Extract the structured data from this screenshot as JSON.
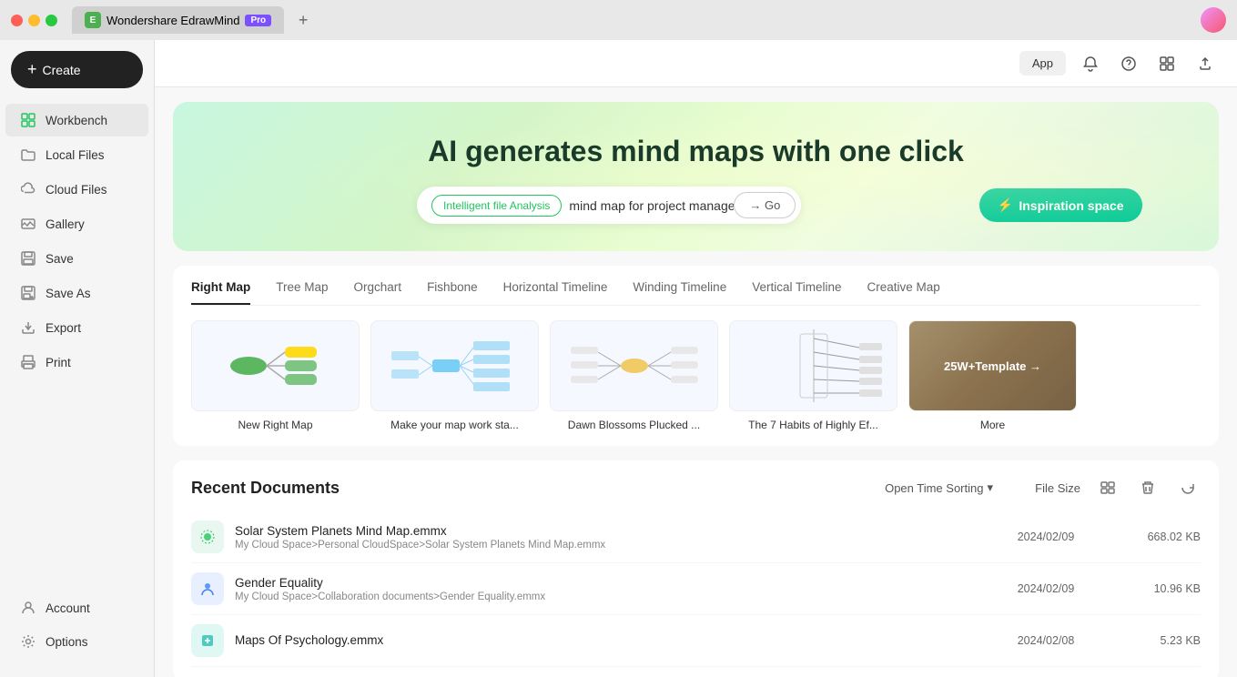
{
  "titleBar": {
    "appName": "Wondershare EdrawMind",
    "proBadge": "Pro",
    "newTabLabel": "+"
  },
  "topBar": {
    "appBtn": "App"
  },
  "sidebar": {
    "createBtn": "Create",
    "items": [
      {
        "id": "workbench",
        "label": "Workbench",
        "icon": "grid-icon",
        "active": true
      },
      {
        "id": "local-files",
        "label": "Local Files",
        "icon": "folder-icon",
        "active": false
      },
      {
        "id": "cloud-files",
        "label": "Cloud Files",
        "icon": "cloud-icon",
        "active": false
      },
      {
        "id": "gallery",
        "label": "Gallery",
        "icon": "chat-icon",
        "active": false
      },
      {
        "id": "save",
        "label": "Save",
        "icon": "save-icon",
        "active": false
      },
      {
        "id": "save-as",
        "label": "Save As",
        "icon": "save-as-icon",
        "active": false
      },
      {
        "id": "export",
        "label": "Export",
        "icon": "export-icon",
        "active": false
      },
      {
        "id": "print",
        "label": "Print",
        "icon": "print-icon",
        "active": false
      }
    ],
    "bottomItems": [
      {
        "id": "account",
        "label": "Account",
        "icon": "account-icon"
      },
      {
        "id": "options",
        "label": "Options",
        "icon": "settings-icon"
      }
    ]
  },
  "hero": {
    "title": "AI generates mind maps with one click",
    "searchTag": "Intelligent file Analysis",
    "searchPlaceholder": "mind map for project managers",
    "searchValue": "mind map for project managers",
    "goBtn": "→ Go",
    "inspirationBtn": "Inspiration space"
  },
  "templates": {
    "tabs": [
      {
        "id": "right-map",
        "label": "Right Map",
        "active": true
      },
      {
        "id": "tree-map",
        "label": "Tree Map",
        "active": false
      },
      {
        "id": "orgchart",
        "label": "Orgchart",
        "active": false
      },
      {
        "id": "fishbone",
        "label": "Fishbone",
        "active": false
      },
      {
        "id": "horizontal-timeline",
        "label": "Horizontal Timeline",
        "active": false
      },
      {
        "id": "winding-timeline",
        "label": "Winding Timeline",
        "active": false
      },
      {
        "id": "vertical-timeline",
        "label": "Vertical Timeline",
        "active": false
      },
      {
        "id": "creative-map",
        "label": "Creative Map",
        "active": false
      }
    ],
    "cards": [
      {
        "id": "new-right-map",
        "label": "New Right Map",
        "type": "new"
      },
      {
        "id": "make-work-map",
        "label": "Make your map work sta...",
        "type": "preview1"
      },
      {
        "id": "dawn-blossoms",
        "label": "Dawn Blossoms Plucked ...",
        "type": "preview2"
      },
      {
        "id": "7-habits",
        "label": "The 7 Habits of Highly Ef...",
        "type": "preview3"
      },
      {
        "id": "more",
        "label": "More",
        "type": "more",
        "moreLabel": "25W+Template →"
      }
    ]
  },
  "recentDocs": {
    "title": "Recent Documents",
    "sortLabel": "Open Time Sorting",
    "fileSizeLabel": "File Size",
    "documents": [
      {
        "id": "solar-system",
        "name": "Solar System Planets Mind Map.emmx",
        "path": "My Cloud Space>Personal CloudSpace>Solar System Planets Mind Map.emmx",
        "date": "2024/02/09",
        "size": "668.02 KB",
        "iconType": "green"
      },
      {
        "id": "gender-equality",
        "name": "Gender Equality",
        "path": "My Cloud Space>Collaboration documents>Gender Equality.emmx",
        "date": "2024/02/09",
        "size": "10.96 KB",
        "iconType": "blue"
      },
      {
        "id": "maps-psychology",
        "name": "Maps Of Psychology.emmx",
        "path": "",
        "date": "2024/02/08",
        "size": "5.23 KB",
        "iconType": "teal"
      }
    ]
  }
}
